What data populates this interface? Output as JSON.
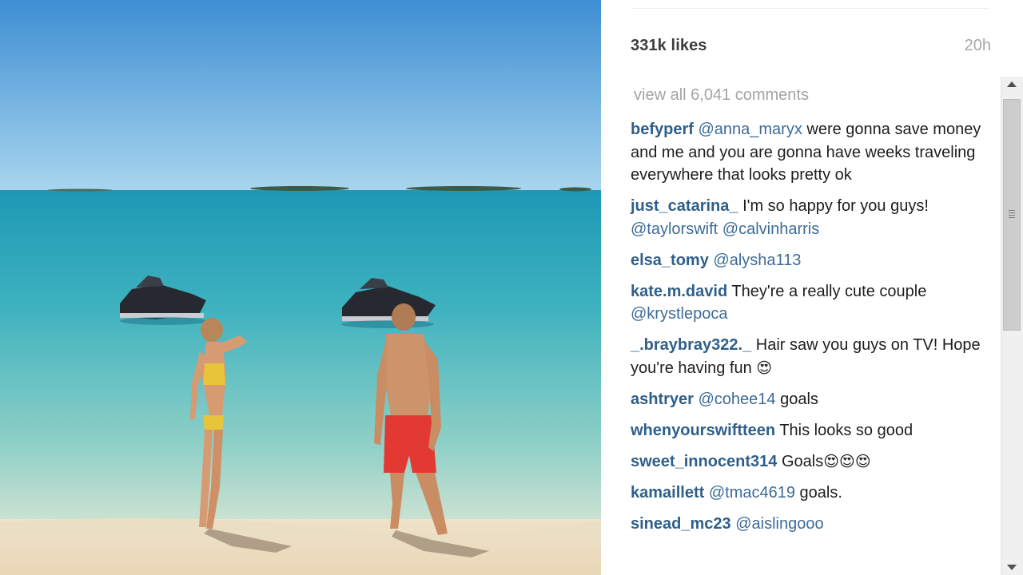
{
  "post": {
    "likes": "331k likes",
    "time": "20h",
    "view_all_comments": "view all 6,041 comments"
  },
  "comments": [
    {
      "user": "befyperf",
      "mention": "@anna_maryx",
      "text": " were gonna save money and me and you are gonna have weeks traveling everywhere that looks pretty ok"
    },
    {
      "user": "just_catarina_",
      "text": " I'm so happy for you guys! ",
      "mention": "@taylorswift",
      "mention2": "@calvinharris"
    },
    {
      "user": "elsa_tomy",
      "mention": "@alysha113"
    },
    {
      "user": "kate.m.david",
      "text": " They're a really cute couple ",
      "mention": "@krystlepoca"
    },
    {
      "user": "_.braybray322._",
      "text": " Hair saw you guys on TV! Hope you're having fun ",
      "emoji": "😍"
    },
    {
      "user": "ashtryer",
      "mention": "@cohee14",
      "text": " goals"
    },
    {
      "user": "whenyourswiftteen",
      "text": " This looks so good"
    },
    {
      "user": "sweet_innocent314",
      "text": " Goals",
      "emoji": "😍😍😍"
    },
    {
      "user": "kamaillett",
      "mention": "@tmac4619",
      "text": " goals."
    },
    {
      "user": "sinead_mc23",
      "mention": "@aislingooo"
    }
  ]
}
